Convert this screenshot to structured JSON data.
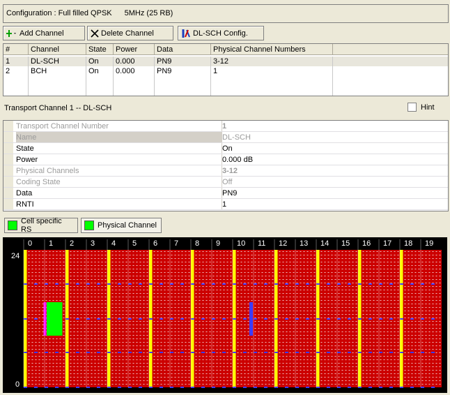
{
  "config": {
    "label": "Configuration : Full filled QPSK",
    "bandwidth": "5MHz (25 RB)"
  },
  "toolbar": {
    "add_label": "Add Channel",
    "delete_label": "Delete Channel",
    "dlsch_label": "DL-SCH Config."
  },
  "channel_table": {
    "headers": [
      "#",
      "Channel",
      "State",
      "Power",
      "Data",
      "Physical Channel Numbers"
    ],
    "rows": [
      {
        "num": "1",
        "channel": "DL-SCH",
        "state": "On",
        "power": "0.000",
        "data": "PN9",
        "phys": "3-12"
      },
      {
        "num": "2",
        "channel": "BCH",
        "state": "On",
        "power": "0.000",
        "data": "PN9",
        "phys": "1"
      }
    ]
  },
  "transport": {
    "title": "Transport Channel 1 -- DL-SCH",
    "hint_label": "Hint",
    "properties": [
      {
        "name": "Transport Channel Number",
        "value": "1",
        "disabled": true
      },
      {
        "name": "Name",
        "value": "DL-SCH",
        "disabled": true
      },
      {
        "name": "State",
        "value": "On",
        "disabled": false
      },
      {
        "name": "Power",
        "value": "0.000 dB",
        "disabled": false
      },
      {
        "name": "Physical Channels",
        "value": "3-12",
        "disabled": true
      },
      {
        "name": "Coding State",
        "value": "Off",
        "disabled": true
      },
      {
        "name": "Data",
        "value": "PN9",
        "disabled": false
      },
      {
        "name": "RNTI",
        "value": "1",
        "disabled": false
      }
    ]
  },
  "legend": {
    "cell_rs_label": "Cell specific RS",
    "physical_channel_label": "Physical Channel",
    "swatch_color": "#00ff00"
  },
  "resource_grid": {
    "x_ticks": [
      "0",
      "1",
      "2",
      "3",
      "4",
      "5",
      "6",
      "7",
      "8",
      "9",
      "10",
      "11",
      "12",
      "13",
      "14",
      "15",
      "16",
      "17",
      "18",
      "19"
    ],
    "y_top_label": "24",
    "y_bottom_label": "0",
    "colors": {
      "background": "#000000",
      "data": "#cc0000",
      "control": "#ffff00",
      "rs": "#3b3bff",
      "highlight": "#00ff00",
      "marker": "#ff00ff"
    }
  }
}
